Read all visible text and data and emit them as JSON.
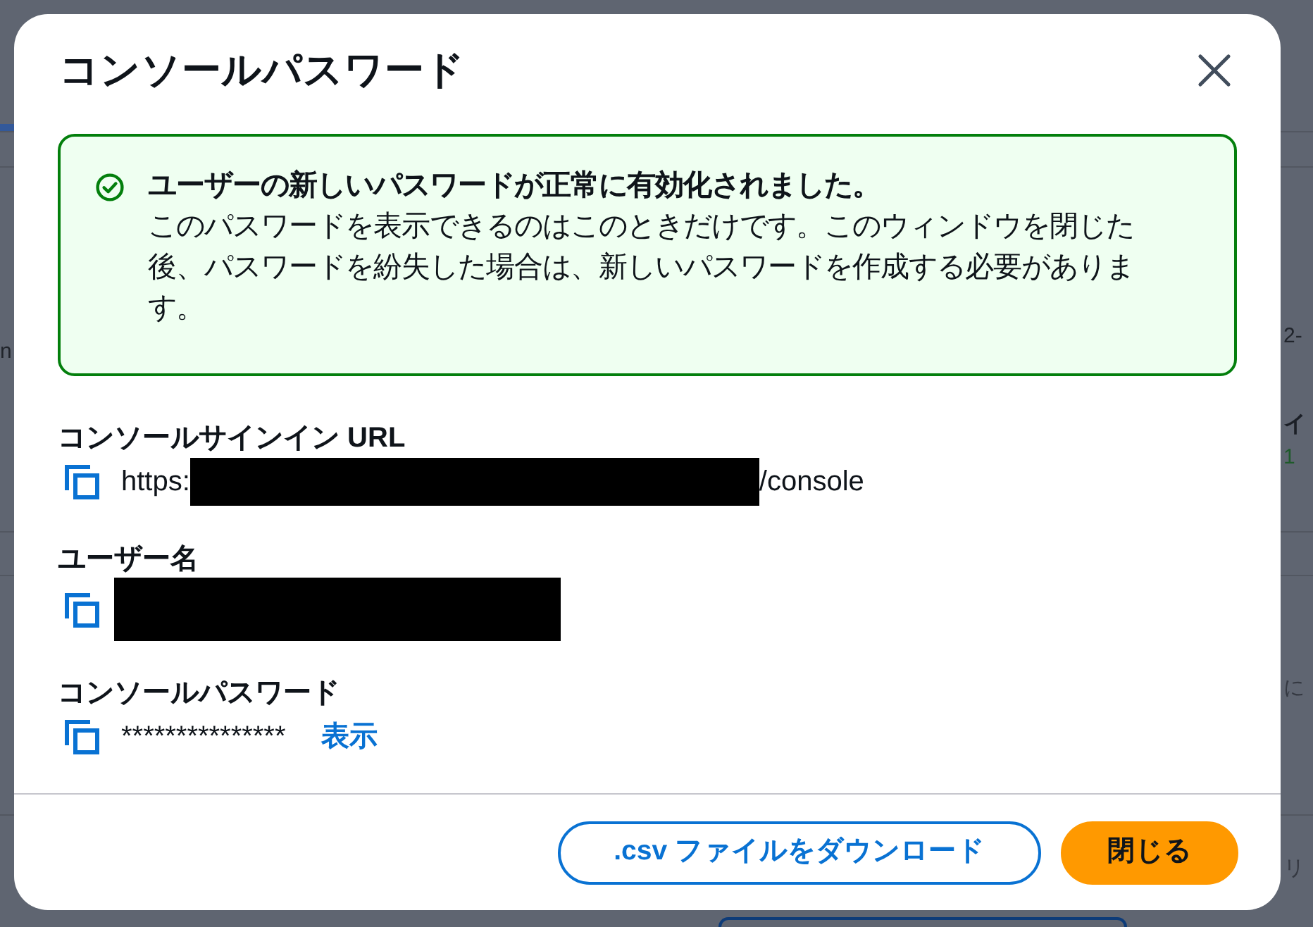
{
  "background_page": {
    "rows": [
      {},
      {},
      {
        "left": [
          {
            "text": "n",
            "kind": "plain"
          }
        ],
        "right": [
          {
            "text": "2-",
            "kind": "plain"
          },
          {
            "text": "イ",
            "kind": "heading"
          },
          {
            "text": "1",
            "kind": "status"
          }
        ]
      },
      {},
      {
        "right": [
          {
            "text": "に",
            "kind": "note"
          }
        ]
      },
      {
        "right": [
          {
            "text": "リ",
            "kind": "note"
          }
        ]
      }
    ]
  },
  "dialog": {
    "title": "コンソールパスワード",
    "alert": {
      "title": "ユーザーの新しいパスワードが正常に有効化されました。",
      "message": "このパスワードを表示できるのはこのときだけです。このウィンドウを閉じた後、パスワードを紛失した場合は、新しいパスワードを作成する必要があります。"
    },
    "fields": [
      {
        "label": "コンソールサインイン URL",
        "kind": "url",
        "prefix": "https:",
        "redacted": true,
        "suffix": "/console"
      },
      {
        "label": "ユーザー名",
        "kind": "username",
        "redacted": true
      },
      {
        "label": "コンソールパスワード",
        "kind": "password",
        "value": "***************",
        "action": "表示"
      }
    ],
    "buttons": [
      {
        "label": ".csv ファイルをダウンロード",
        "kind": "download"
      },
      {
        "label": "閉じる",
        "kind": "close"
      }
    ]
  }
}
